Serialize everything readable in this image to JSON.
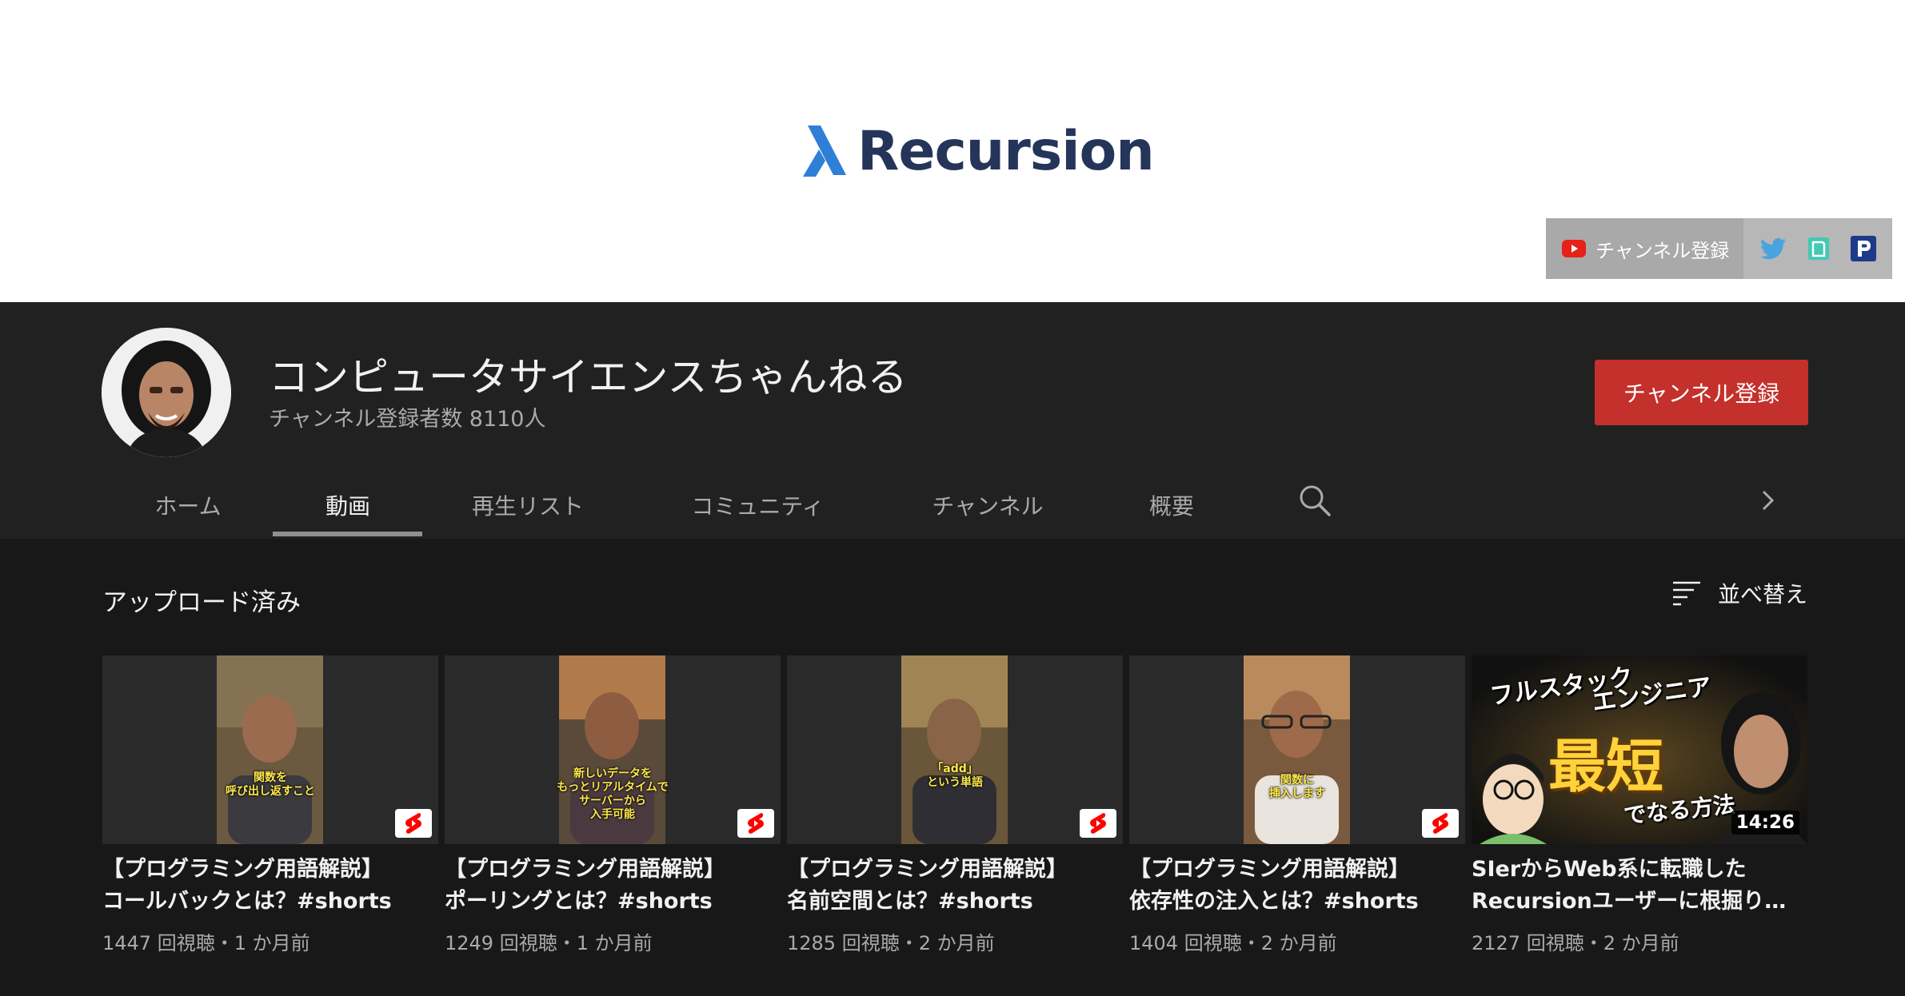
{
  "banner": {
    "logo_text": "Recursion",
    "links": {
      "subscribe_label": "チャンネル登録",
      "icons": [
        "youtube-icon",
        "twitter-icon",
        "note-icon",
        "p-icon"
      ]
    }
  },
  "channel": {
    "title": "コンピュータサイエンスちゃんねる",
    "subscribers": "チャンネル登録者数 8110人",
    "subscribe_button": "チャンネル登録"
  },
  "tabs": [
    {
      "label": "ホーム"
    },
    {
      "label": "動画",
      "active": true
    },
    {
      "label": "再生リスト"
    },
    {
      "label": "コミュニティ"
    },
    {
      "label": "チャンネル"
    },
    {
      "label": "概要"
    }
  ],
  "section": {
    "title": "アップロード済み",
    "sort_label": "並べ替え"
  },
  "videos": [
    {
      "title_line1": "【プログラミング用語解説】",
      "title_line2": "コールバックとは？#shorts",
      "meta": "1447 回視聴・1 か月前",
      "caption": "関数を\n呼び出し返すこと",
      "is_short": true
    },
    {
      "title_line1": "【プログラミング用語解説】",
      "title_line2": "ポーリングとは？#shorts",
      "meta": "1249 回視聴・1 か月前",
      "caption": "新しいデータを\nもっとリアルタイムで\nサーバーから\n入手可能",
      "is_short": true
    },
    {
      "title_line1": "【プログラミング用語解説】",
      "title_line2": "名前空間とは？#shorts",
      "meta": "1285 回視聴・2 か月前",
      "caption": "「add」\nという単語",
      "is_short": true
    },
    {
      "title_line1": "【プログラミング用語解説】",
      "title_line2": "依存性の注入とは？#shorts",
      "meta": "1404 回視聴・2 か月前",
      "caption": "関数に\n挿入します",
      "is_short": true
    },
    {
      "title_line1": "SIerからWeb系に転職した",
      "title_line2": "Recursionユーザーに根掘り…",
      "meta": "2127 回視聴・2 か月前",
      "duration": "14:26",
      "thumb_text1": "フルスタック",
      "thumb_text2": "エンジニア",
      "thumb_text3": "最短",
      "thumb_text4": "でなる方法",
      "is_short": false
    }
  ],
  "colors": {
    "accent": "#c4302b",
    "logo": "#25355a",
    "logo_mark": "#2f7fd6",
    "caption": "#ffe94a"
  }
}
